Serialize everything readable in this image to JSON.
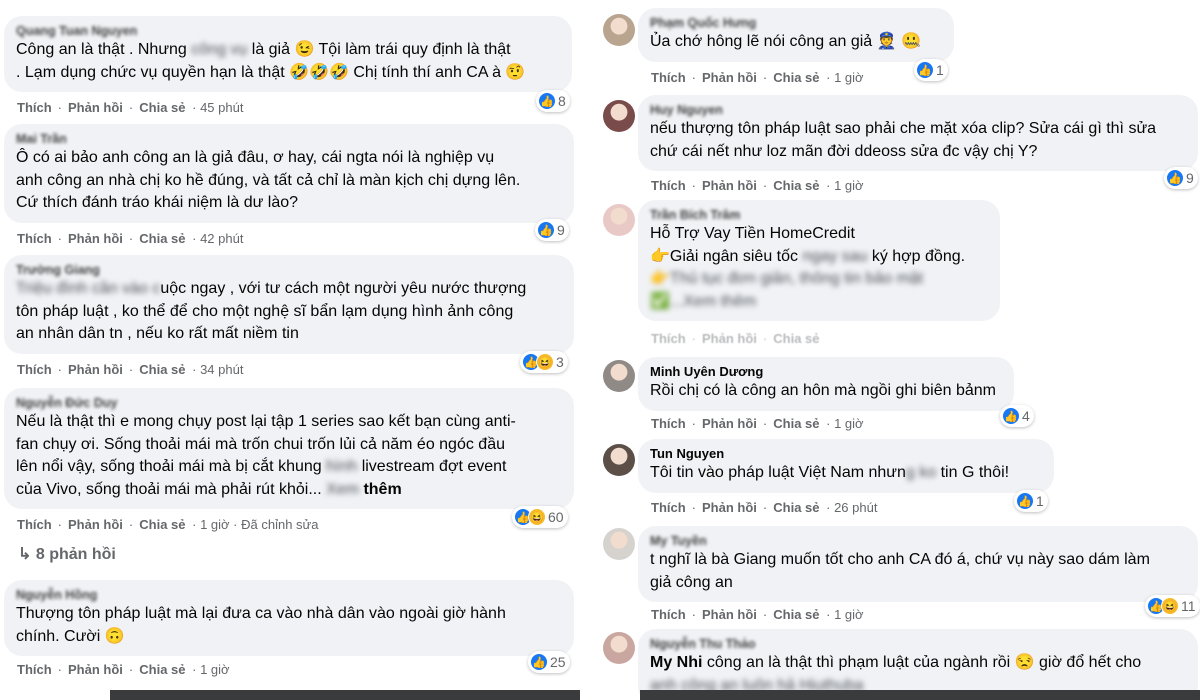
{
  "actions": {
    "like": "Thích",
    "reply": "Phản hồi",
    "share": "Chia sẻ",
    "sep": "·"
  },
  "left": [
    {
      "author": "Quang Tuan Nguyen",
      "lines": [
        [
          "Công an là thật . Nhưng ",
          "{blur}công vụ",
          " là giả 😉 Tội làm trái quy định là thật"
        ],
        [
          ". Lạm dụng chức vụ quyền hạn là thật 🤣🤣🤣 Chị tính thí anh CA à 🤨"
        ]
      ],
      "time": "45 phút",
      "reactions": "8",
      "react_icons": [
        "like"
      ]
    },
    {
      "author": "Mai Trần",
      "lines": [
        [
          "Ô có ai bảo anh công an là giả đâu, ơ hay, cái ngta nói là nghiệp vụ"
        ],
        [
          "anh công an nhà chị ko hề đúng, và tất cả chỉ là màn kịch chị dựng lên."
        ],
        [
          "Cứ thích đánh tráo khái niệm là dư lào?"
        ]
      ],
      "time": "42 phút",
      "reactions": "9",
      "react_icons": [
        "like"
      ]
    },
    {
      "author": "Trường Giang",
      "lines": [
        [
          "{blur}Triệu đình cần vào c",
          "uộc ngay , với tư cách một người yêu nước thượng"
        ],
        [
          "tôn pháp luật , ko thể để cho một nghệ sĩ bẩn lạm dụng hình ảnh công"
        ],
        [
          "an nhân dân tn , nếu ko rất mất niềm tin"
        ]
      ],
      "time": "34 phút",
      "reactions": "3",
      "react_icons": [
        "like",
        "haha"
      ]
    },
    {
      "author": "Nguyễn Đức Duy",
      "lines": [
        [
          "Nếu là thật thì e mong chụy post lại tập 1 series sao kết bạn cùng anti-"
        ],
        [
          "fan chụy ơi. Sống thoải mái mà trốn chui trốn lủi cả năm éo ngóc đầu"
        ],
        [
          "lên nổi vậy, sống thoải mái mà bị cắt khung ",
          "{blur}hình",
          " livestream đợt event"
        ],
        [
          "của Vivo, sống thoải mái mà phải rút khỏi... ",
          "{blur}Xem",
          "{more} thêm"
        ]
      ],
      "time": "1 giờ",
      "edited": "Đã chỉnh sửa",
      "reactions": "60",
      "react_icons": [
        "like",
        "haha"
      ]
    },
    {
      "author": "Nguyễn Hồng",
      "lines": [
        [
          "Thượng tôn pháp luật mà lại đưa ca vào nhà dân vào ngoài giờ hành"
        ],
        [
          "chính. Cười 🙃"
        ]
      ],
      "time": "1 giờ",
      "reactions": "25",
      "react_icons": [
        "like"
      ]
    }
  ],
  "replies_label": "8 phản hồi",
  "right": [
    {
      "author": "Phạm Quốc Hưng",
      "lines": [
        [
          "Ủa chớ hông lẽ nói công an giả 👮 🤐"
        ]
      ],
      "time": "1 giờ",
      "reactions": "1",
      "react_icons": [
        "like"
      ]
    },
    {
      "author": "Huy Nguyen",
      "lines": [
        [
          "nếu thượng tôn pháp luật sao phải che mặt xóa clip? Sửa cái gì thì sửa"
        ],
        [
          "chứ cái nết như loz mãn đời ddeoss sửa đc vậy chị Y?"
        ]
      ],
      "time": "1 giờ",
      "reactions": "9",
      "react_icons": [
        "like"
      ]
    },
    {
      "author": "Trần Bích Trâm",
      "lines": [
        [
          "Hỗ Trợ Vay Tiền HomeCredit"
        ],
        [
          "👉Giải ngân siêu tốc ",
          "{blur}ngay sau",
          " ký hợp đồng."
        ],
        [
          "{blur}👉Thủ tục đơn giản, thông tin bảo mật"
        ],
        [
          "{blur}✅...Xem thêm"
        ]
      ],
      "time": "",
      "faded": true,
      "reactions": "",
      "react_icons": []
    },
    {
      "author": "Minh Uyên Dương",
      "author_clear": true,
      "lines": [
        [
          "Rồi chị có là công an hôn mà ngồi ghi biên bảnm"
        ]
      ],
      "time": "1 giờ",
      "reactions": "4",
      "react_icons": [
        "like"
      ]
    },
    {
      "author": "Tun Nguyen",
      "author_clear": true,
      "lines": [
        [
          "Tôi tin vào pháp luật Việt Nam nhưn",
          "{blur}g ko",
          " tin G thôi!"
        ]
      ],
      "time": "26 phút",
      "reactions": "1",
      "react_icons": [
        "like"
      ]
    },
    {
      "author": "My Tuyền",
      "lines": [
        [
          "t nghĩ là bà Giang muốn tốt cho anh CA đó á, chứ vụ này sao dám làm"
        ],
        [
          "giả công an"
        ]
      ],
      "time": "1 giờ",
      "reactions": "11",
      "react_icons": [
        "like",
        "haha"
      ]
    },
    {
      "author": "Nguyễn Thu Thảo",
      "lines": [
        [
          "{strong}My Nhi",
          " công an là thật thì phạm luật của ngành rồi 😒 giờ đổ hết cho"
        ],
        [
          "{blur}anh công an luôn hả Hiuthuba"
        ]
      ],
      "time": "",
      "reactions": "",
      "react_icons": []
    }
  ]
}
